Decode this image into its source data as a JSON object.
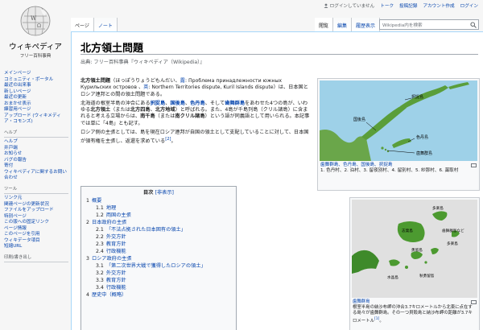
{
  "logo": {
    "title": "ウィキペディア",
    "subtitle": "フリー百科事典"
  },
  "personal_tools": {
    "anon": "ログインしていません",
    "items": [
      "トーク",
      "投稿記録",
      "アカウント作成",
      "ログイン"
    ]
  },
  "tabs_left": [
    "ページ",
    "ノート"
  ],
  "tabs_right": [
    "閲覧",
    "編集",
    "履歴表示"
  ],
  "search": {
    "placeholder": "Wikipedia内を検索"
  },
  "sidebar": {
    "main": [
      "メインページ",
      "コミュニティ・ポータル",
      "最近の出来事",
      "新しいページ",
      "最近の更新",
      "おまかせ表示",
      "練習用ページ",
      "アップロード (ウィキメディア・コモンズ)"
    ],
    "help_head": "ヘルプ",
    "help": [
      "ヘルプ",
      "井戸端",
      "お知らせ",
      "バグの報告",
      "寄付",
      "ウィキペディアに関するお問い合わせ"
    ],
    "tools_head": "ツール",
    "tools": [
      "リンク元",
      "関連ページの更新状況",
      "ファイルをアップロード",
      "特別ページ",
      "この版への固定リンク",
      "ページ情報",
      "このページを引用",
      "ウィキデータ項目",
      "短縮URL"
    ],
    "print_head": "印刷/書き出し"
  },
  "article": {
    "title": "北方領土問題",
    "from": "出典: フリー百科事典『ウィキペディア（Wikipedia）』",
    "p1": {
      "b1": "北方領土問題",
      "t1": "（ほっぽうりょうどもんだい、",
      "ru_label": "露",
      "t2": ": Проблема принадлежности южных Курильских островов 、",
      "en_label": "英",
      "t3": ": Northern Territories dispute, Kuril Islands dispute）は、日本国とロシア連邦との間の領土問題である。"
    },
    "p2": {
      "t1": "北海道の根室半島の沖合にある",
      "l1": "択捉島",
      "s1": "、",
      "l2": "国後島",
      "s2": "、",
      "l3": "色丹島",
      "t2": "、そして",
      "l4": "歯舞群島",
      "t3": "をあわせた4つの島が、いわゆる",
      "b1": "北方領土",
      "t4": "（または",
      "b2": "北方四島",
      "t5": "、",
      "b3": "北方地域",
      "t6": "）と呼ばれる。また、4島が千島列島（クリル諸島）に含まれると考える立場からは、",
      "b4": "南千島",
      "t7": "（または",
      "b5": "南クリル諸島",
      "t8": "）という語が同義語として用いられる。本記事では単に「4島」とも記す。"
    },
    "p3": {
      "t1": "ロシア側の主張としては、島を現在ロシア連邦が自国の領土として支配していることに対して、日本国が領有権を主張し、返還を求めている",
      "ref": "[2]",
      "t2": "。"
    }
  },
  "toc": {
    "title": "目次",
    "toggle": "[非表示]",
    "items": [
      {
        "num": "1",
        "text": "概要",
        "level": 1
      },
      {
        "num": "1.1",
        "text": "地理",
        "level": 2
      },
      {
        "num": "1.2",
        "text": "両国の主張",
        "level": 2
      },
      {
        "num": "2",
        "text": "日本政府の主張",
        "level": 1
      },
      {
        "num": "2.1",
        "text": "「不法占拠された日本固有の領土」",
        "level": 2
      },
      {
        "num": "2.2",
        "text": "外交方針",
        "level": 2
      },
      {
        "num": "2.3",
        "text": "教育方針",
        "level": 2
      },
      {
        "num": "2.4",
        "text": "行政機能",
        "level": 2
      },
      {
        "num": "3",
        "text": "ロシア政府の主張",
        "level": 1
      },
      {
        "num": "3.1",
        "text": "「第二次世界大戦で獲得したロシアの領土」",
        "level": 2
      },
      {
        "num": "3.2",
        "text": "外交方針",
        "level": 2
      },
      {
        "num": "3.3",
        "text": "教育方針",
        "level": 2
      },
      {
        "num": "3.4",
        "text": "行政機能",
        "level": 2
      },
      {
        "num": "4",
        "text": "歴史中（概略）",
        "level": 1
      }
    ]
  },
  "thumb1": {
    "labels": {
      "etorofu": "択捉島",
      "kunashiri": "国後島",
      "shikotan": "色丹島",
      "habomai": "歯舞群島"
    },
    "caption_title": "歯舞群島、色丹島、国後島、択捉島",
    "caption_body": "1. 色丹村、2. 泊村、3. 留夜別村、4. 留別村、5. 紗那村、6. 蘂取村"
  },
  "thumb2": {
    "labels": {
      "tarakuto": "多楽島",
      "shibotsu": "志発島",
      "habomai": "歯舞群島など",
      "taraku": "多楽島",
      "yuri": "勇留島",
      "akiyuri": "秋勇留島",
      "suisho": "水晶島"
    },
    "caption_title": "歯舞群島",
    "caption_body": "根室半島の納沙布岬の沖合3.7キロメートルから北東に点在する島々が歯舞群島。その一つ貝殻島と納沙布岬の距離が3.7キロメートル",
    "ref": "[1]",
    "caption_end": "。"
  },
  "colors": {
    "link": "#0645ad",
    "border": "#a7d7f9",
    "sea": "#9ed1e8",
    "land": "#5a9e3a"
  }
}
